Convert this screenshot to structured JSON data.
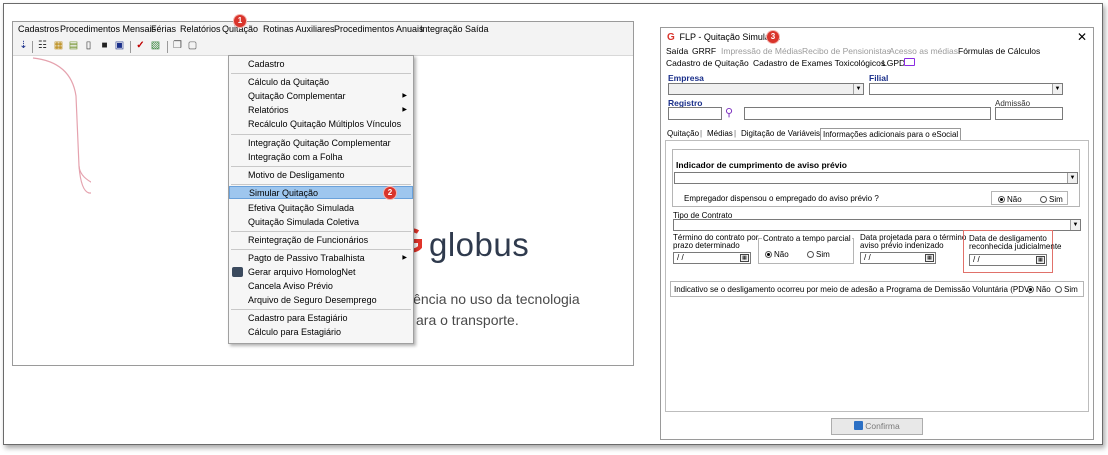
{
  "left": {
    "menubar": [
      "Cadastros",
      "Procedimentos Mensais",
      "Férias",
      "Relatórios",
      "Quitação",
      "Rotinas Auxiliares",
      "Procedimentos Anuais",
      "Integração",
      "Saída"
    ],
    "brand": "globus",
    "tagline": [
      "iência no uso da tecnologia",
      "ara o transporte."
    ],
    "dropdown": [
      "Cadastro",
      "Cálculo da Quitação",
      "Quitação Complementar",
      "Relatórios",
      "Recálculo Quitação Múltiplos Vínculos",
      "Integração Quitação Complementar",
      "Integração com a Folha",
      "Motivo de Desligamento",
      "Simular Quitação",
      "Efetiva Quitação Simulada",
      "Quitação Simulada Coletiva",
      "Reintegração de Funcionários",
      "Pagto de Passivo Trabalhista",
      "Gerar arquivo HomologNet",
      "Cancela Aviso Prévio",
      "Arquivo de Seguro Desemprego",
      "Cadastro para Estagiário",
      "Cálculo para Estagiário"
    ],
    "badges": [
      "1",
      "2"
    ]
  },
  "right": {
    "title": "FLP - Quitação Simulada",
    "badge": "3",
    "menu1": [
      "Saída",
      "GRRF",
      "Impressão de Médias",
      "Recibo de Pensionistas",
      "Acesso as médias",
      "Fórmulas de Cálculos"
    ],
    "menu2": [
      "Cadastro de Quitação",
      "Cadastro de Exames Toxicológicos",
      "LGPD"
    ],
    "labels": {
      "empresa": "Empresa",
      "filial": "Filial",
      "registro": "Registro",
      "admissao": "Admissão"
    },
    "tabs": [
      "Quitação",
      "Médias",
      "Digitação de Variáveis",
      "Informações adicionais para o eSocial"
    ],
    "aviso_header": "Indicador de cumprimento de aviso prévio",
    "dispensou_q": "Empregador dispensou o empregado do aviso prévio ?",
    "nao": "Não",
    "sim": "Sim",
    "tipo_contrato": "Tipo de Contrato",
    "termino_label": [
      "Término do contrato por",
      "prazo determinado"
    ],
    "tempo_parcial": "Contrato a tempo parcial",
    "data_projetada": [
      "Data projetada para o término",
      "aviso prévio indenizado"
    ],
    "data_deslig": [
      "Data de desligamento",
      "reconhecida judicialmente"
    ],
    "date_placeholder": "/ /",
    "pdv_question": "Indicativo se o desligamento ocorreu por meio de adesão a Programa de Demissão Voluntária (PDV)",
    "confirm": "Confirma"
  }
}
